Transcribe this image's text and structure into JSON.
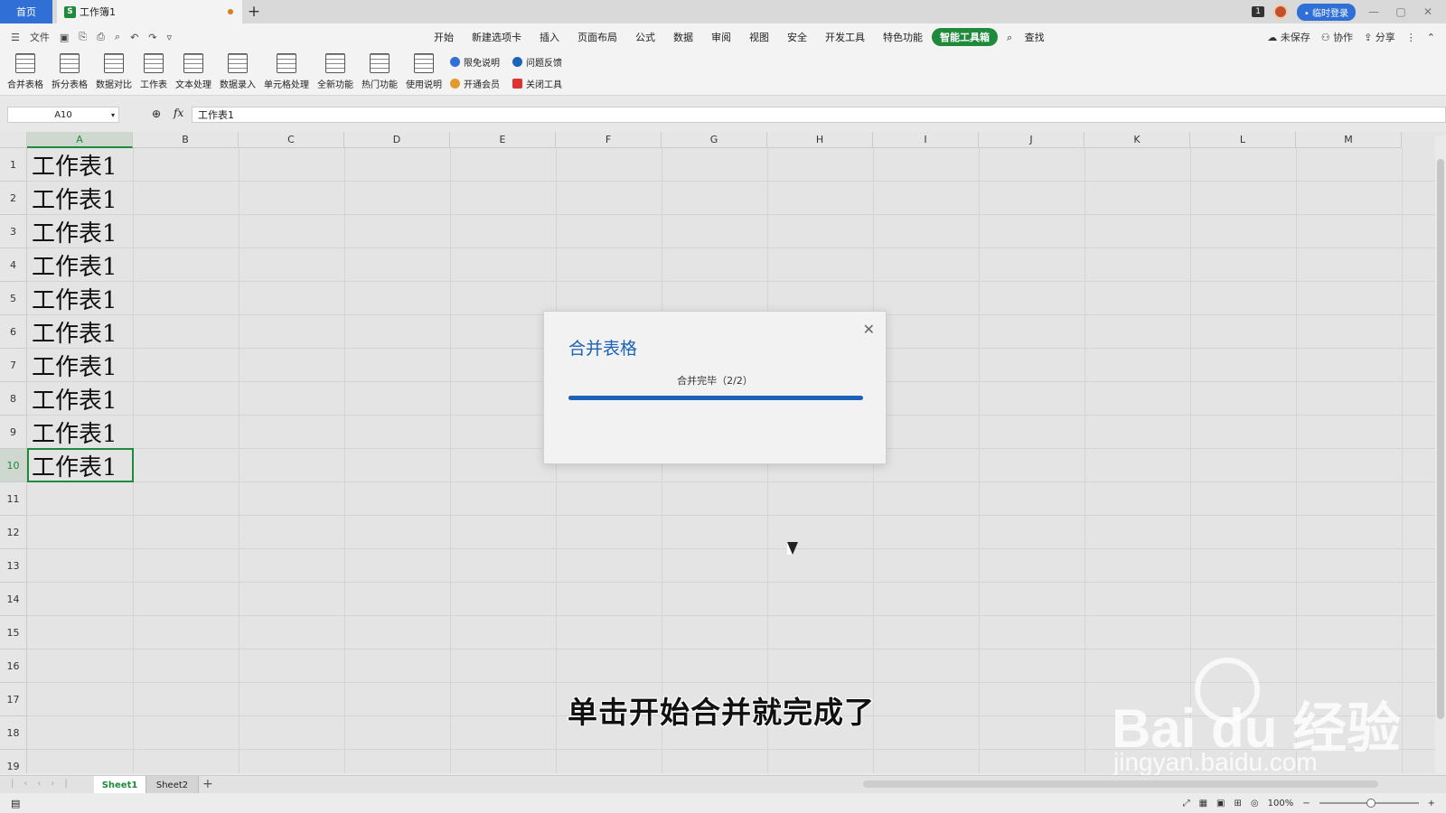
{
  "titlebar": {
    "home": "首页",
    "doc_tab": "工作簿1",
    "doc_icon": "S",
    "new_tab": "+",
    "badge": "1",
    "login": "• 临时登录",
    "min": "—",
    "max": "▢",
    "close": "✕"
  },
  "menubar": {
    "file": "文件",
    "tabs": [
      "开始",
      "新建选项卡",
      "插入",
      "页面布局",
      "公式",
      "数据",
      "审阅",
      "视图",
      "安全",
      "开发工具",
      "特色功能",
      "智能工具箱",
      "查找"
    ],
    "active_tab": "智能工具箱",
    "unsaved": "未保存",
    "collab": "协作",
    "share": "分享"
  },
  "ribbon": {
    "buttons": [
      "合并表格",
      "拆分表格",
      "数据对比",
      "工作表",
      "文本处理",
      "数据录入",
      "单元格处理",
      "全新功能",
      "热门功能",
      "使用说明"
    ],
    "small": [
      {
        "label": "限免说明",
        "icon": "tag-icon"
      },
      {
        "label": "开通会员",
        "icon": "crown-icon"
      },
      {
        "label": "问题反馈",
        "icon": "question-icon"
      },
      {
        "label": "关闭工具",
        "icon": "close-box-icon"
      }
    ]
  },
  "formula": {
    "cell_ref": "A10",
    "fx": "fx",
    "value": "工作表1"
  },
  "grid": {
    "columns": [
      "A",
      "B",
      "C",
      "D",
      "E",
      "F",
      "G",
      "H",
      "I",
      "J",
      "K",
      "L",
      "M"
    ],
    "rows": [
      "1",
      "2",
      "3",
      "4",
      "5",
      "6",
      "7",
      "8",
      "9",
      "10",
      "11",
      "12",
      "13",
      "14",
      "15",
      "16",
      "17",
      "18",
      "19"
    ],
    "cells": [
      "工作表1",
      "工作表1",
      "工作表1",
      "工作表1",
      "工作表1",
      "工作表1",
      "工作表1",
      "工作表1",
      "工作表1",
      "工作表1"
    ],
    "selected_cell": "A10"
  },
  "dialog": {
    "title": "合并表格",
    "status": "合并完毕（2/2）",
    "progress": 1.0,
    "close": "✕"
  },
  "caption": "单击开始合并就完成了",
  "watermark": {
    "logo": "Bai du 经验",
    "url": "jingyan.baidu.com"
  },
  "sheets": {
    "tabs": [
      "Sheet1",
      "Sheet2"
    ],
    "active": "Sheet1",
    "add": "+"
  },
  "statusbar": {
    "zoom": "100%"
  },
  "colors": {
    "accent_green": "#1f8a3c",
    "dialog_blue": "#1c62b8",
    "home_blue": "#2f6fd6"
  }
}
